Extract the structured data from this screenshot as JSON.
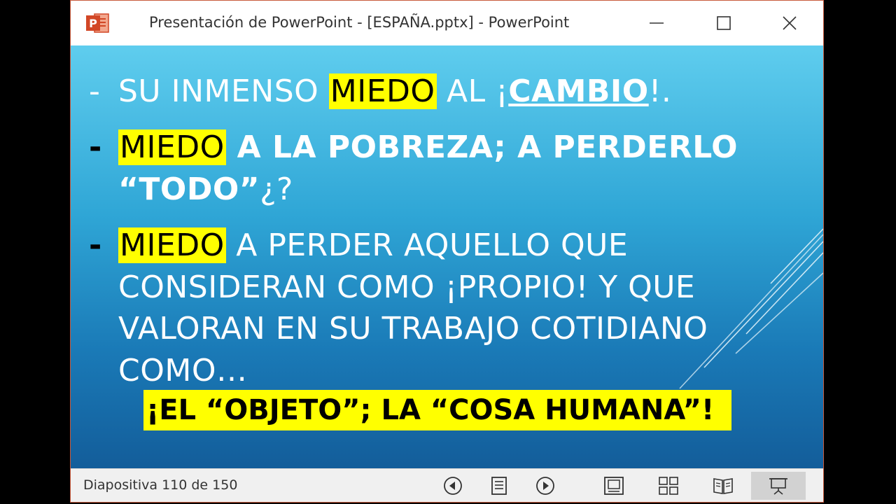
{
  "window": {
    "title": "Presentación de PowerPoint - [ESPAÑA.pptx] - PowerPoint",
    "app_icon_letter": "P",
    "minimize_icon": "minimize-icon",
    "maximize_icon": "maximize-icon",
    "close_icon": "close-icon"
  },
  "slide": {
    "bullet": "-",
    "line1": {
      "a": "SU INMENSO ",
      "hl": "MIEDO",
      "b": " AL ¡",
      "c": "CAMBIO",
      "d": "!."
    },
    "line2": {
      "hl": "MIEDO",
      "a": " A LA POBREZA; A PERDERLO"
    },
    "line3": {
      "a": "“TODO”",
      "b": "¿?"
    },
    "line4": {
      "hl": "MIEDO",
      "a": " A PERDER AQUELLO QUE"
    },
    "line5": "CONSIDERAN  COMO ¡PROPIO! Y QUE",
    "line6": "VALORAN EN SU TRABAJO COTIDIANO",
    "line7": "COMO…",
    "final": "¡EL “OBJETO”; LA “COSA HUMANA”!"
  },
  "status": {
    "slide_counter": "Diapositiva 110 de 150",
    "icons": [
      "previous-icon",
      "menu-icon",
      "next-icon",
      "normal-view-icon",
      "slide-sorter-icon",
      "reading-view-icon",
      "slideshow-icon"
    ]
  },
  "colors": {
    "highlight": "#ffff00",
    "titlebar_border": "#c85a3c",
    "app_icon": "#d24726"
  }
}
